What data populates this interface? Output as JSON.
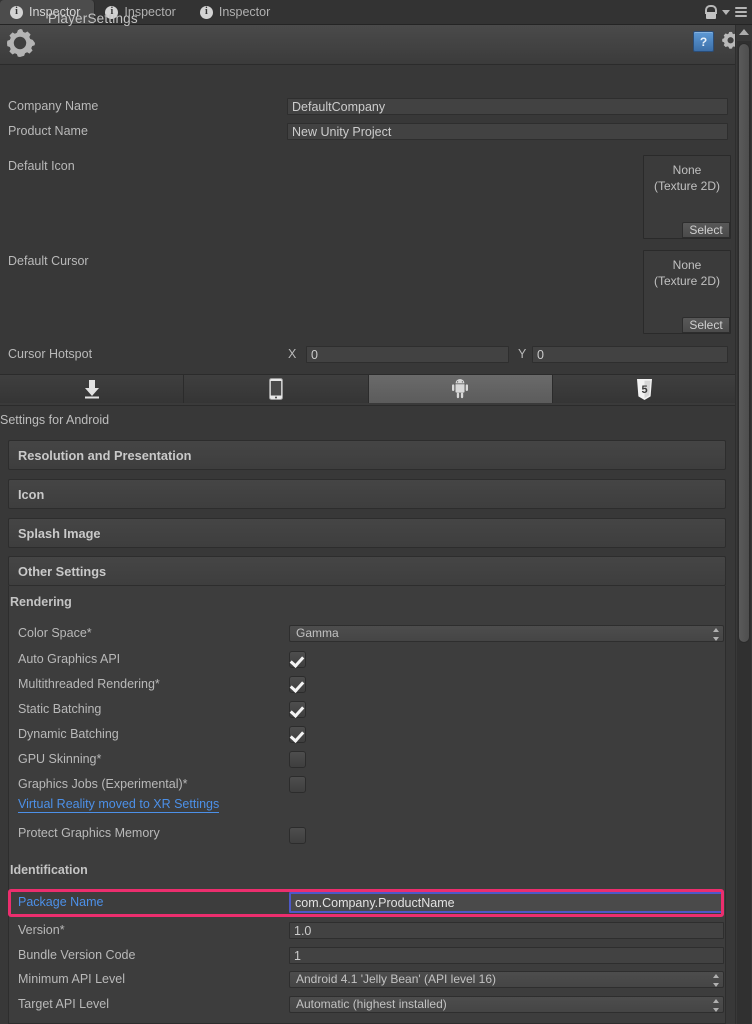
{
  "window": {
    "tabs": [
      {
        "label": "Inspector",
        "icon": "info-icon",
        "active": true
      },
      {
        "label": "Inspector",
        "icon": "info-icon",
        "active": false
      },
      {
        "label": "Inspector",
        "icon": "info-icon",
        "active": false
      }
    ],
    "lock_icon": "unlocked-padlock-icon",
    "menu_icon": "hamburger-menu-icon",
    "caret_icon": "chevron-down-icon"
  },
  "header": {
    "icon": "gear-icon",
    "title": "PlayerSettings",
    "help_icon": "help-book-icon",
    "help_glyph": "?",
    "settings_icon": "gear-icon"
  },
  "general": {
    "company_name": {
      "label": "Company Name",
      "value": "DefaultCompany"
    },
    "product_name": {
      "label": "Product Name",
      "value": "New Unity Project"
    },
    "default_icon": {
      "label": "Default Icon",
      "value_line1": "None",
      "value_line2": "(Texture 2D)",
      "select_label": "Select"
    },
    "default_cursor": {
      "label": "Default Cursor",
      "value_line1": "None",
      "value_line2": "(Texture 2D)",
      "select_label": "Select"
    },
    "cursor_hotspot": {
      "label": "Cursor Hotspot",
      "x_label": "X",
      "x_value": "0",
      "y_label": "Y",
      "y_value": "0"
    }
  },
  "platform_tabs": [
    {
      "name": "standalone",
      "icon": "download-arrow-icon",
      "selected": false
    },
    {
      "name": "ios",
      "icon": "iphone-icon",
      "selected": false
    },
    {
      "name": "android",
      "icon": "android-robot-icon",
      "selected": true
    },
    {
      "name": "webgl",
      "icon": "html5-shield-icon",
      "selected": false
    }
  ],
  "settings_for": "Settings for Android",
  "sections": [
    {
      "label": "Resolution and Presentation"
    },
    {
      "label": "Icon"
    },
    {
      "label": "Splash Image"
    }
  ],
  "other_settings": {
    "title": "Other Settings",
    "rendering": {
      "heading": "Rendering",
      "color_space": {
        "label": "Color Space*",
        "value": "Gamma",
        "type": "popup"
      },
      "toggles": [
        {
          "label": "Auto Graphics API",
          "checked": true
        },
        {
          "label": "Multithreaded Rendering*",
          "checked": true
        },
        {
          "label": "Static Batching",
          "checked": true
        },
        {
          "label": "Dynamic Batching",
          "checked": true
        },
        {
          "label": "GPU Skinning*",
          "checked": false
        },
        {
          "label": "Graphics Jobs (Experimental)*",
          "checked": false
        }
      ],
      "xr_link": "Virtual Reality moved to XR Settings",
      "protect_graphics_memory": {
        "label": "Protect Graphics Memory",
        "checked": false
      }
    },
    "identification": {
      "heading": "Identification",
      "package_name": {
        "label": "Package Name",
        "value": "com.Company.ProductName",
        "highlighted": true,
        "focused": true
      },
      "version": {
        "label": "Version*",
        "value": "1.0"
      },
      "bundle_version_code": {
        "label": "Bundle Version Code",
        "value": "1"
      },
      "minimum_api_level": {
        "label": "Minimum API Level",
        "value": "Android 4.1 'Jelly Bean' (API level 16)",
        "type": "popup"
      },
      "target_api_level": {
        "label": "Target API Level",
        "value": "Automatic (highest installed)",
        "type": "popup"
      }
    }
  },
  "colors": {
    "highlight": "#ec2e6e",
    "focus_border": "#4d58c8",
    "link": "#4c90e8",
    "background": "#383838",
    "panel": "#3d3d3d"
  }
}
